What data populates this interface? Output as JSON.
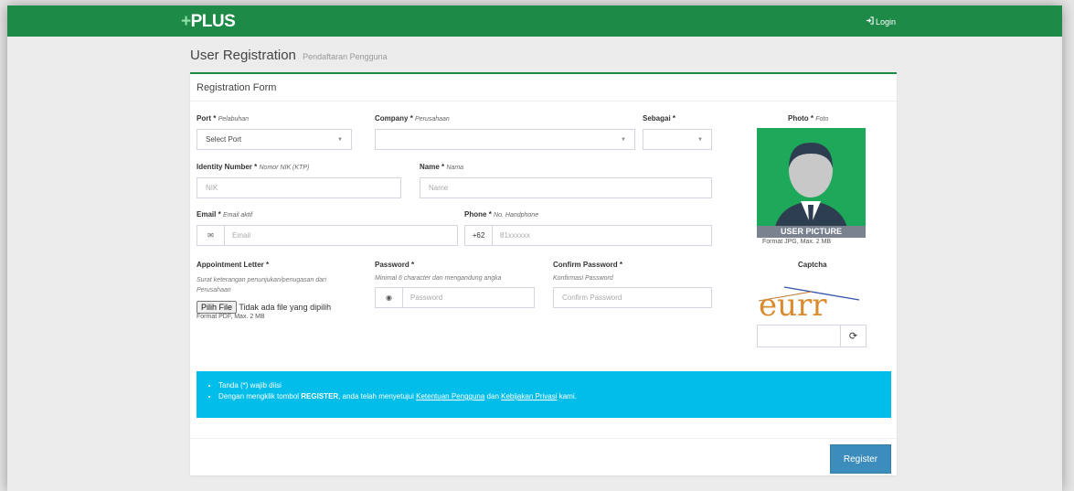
{
  "app": {
    "logo": "PLUS",
    "login_label": "Login"
  },
  "page": {
    "title": "User Registration",
    "subtitle": "Pendaftaran Pengguna"
  },
  "form": {
    "header": "Registration Form",
    "port": {
      "label": "Port",
      "hint": "Pelabuhan",
      "value": "Select Port"
    },
    "company": {
      "label": "Company",
      "hint": "Perusahaan",
      "value": ""
    },
    "sebagai": {
      "label": "Sebagai",
      "value": ""
    },
    "photo": {
      "label": "Photo",
      "hint": "Foto",
      "caption": "USER PICTURE",
      "format": "Format JPG, Max. 2 MB"
    },
    "identity": {
      "label": "Identity Number",
      "hint": "Nomor NIK (KTP)",
      "placeholder": "NIK"
    },
    "name": {
      "label": "Name",
      "hint": "Nama",
      "placeholder": "Name"
    },
    "email": {
      "label": "Email",
      "hint": "Email aktif",
      "placeholder": "Email"
    },
    "phone": {
      "label": "Phone",
      "hint": "No. Handphone",
      "prefix": "+62",
      "placeholder": "81xxxxxx"
    },
    "appointment": {
      "label": "Appointment Letter",
      "hint": "Surat keterangan penunjukan/penugasan dari Perusahaan",
      "button": "Pilih File",
      "no_file": "Tidak ada file yang dipilih",
      "format": "Format PDF, Max. 2 MB"
    },
    "password": {
      "label": "Password",
      "hint": "Minimal 6 character dan mengandung angka",
      "placeholder": "Password"
    },
    "confirm": {
      "label": "Confirm Password",
      "hint": "Konfirmasi Password",
      "placeholder": "Confirm Password"
    },
    "captcha": {
      "label": "Captcha",
      "image_text": "eurr",
      "value": ""
    },
    "required_mark": "*"
  },
  "info": {
    "item1": "Tanda (*) wajib diisi",
    "item2_prefix": "Dengan mengklik tombol ",
    "item2_bold": "REGISTER",
    "item2_mid": ", anda telah menyetujui ",
    "link_terms": "Ketentuan Pengguna",
    "item2_and": " dan ",
    "link_privacy": "Kebijakan Privasi",
    "item2_suffix": " kami."
  },
  "actions": {
    "register": "Register"
  },
  "colors": {
    "navbar": "#1e8a48",
    "info": "#00bde9",
    "primary": "#3c8dbc"
  },
  "icons": {
    "login": "sign-in-icon",
    "email": "envelope-icon",
    "password": "eye-icon",
    "refresh": "refresh-icon"
  }
}
